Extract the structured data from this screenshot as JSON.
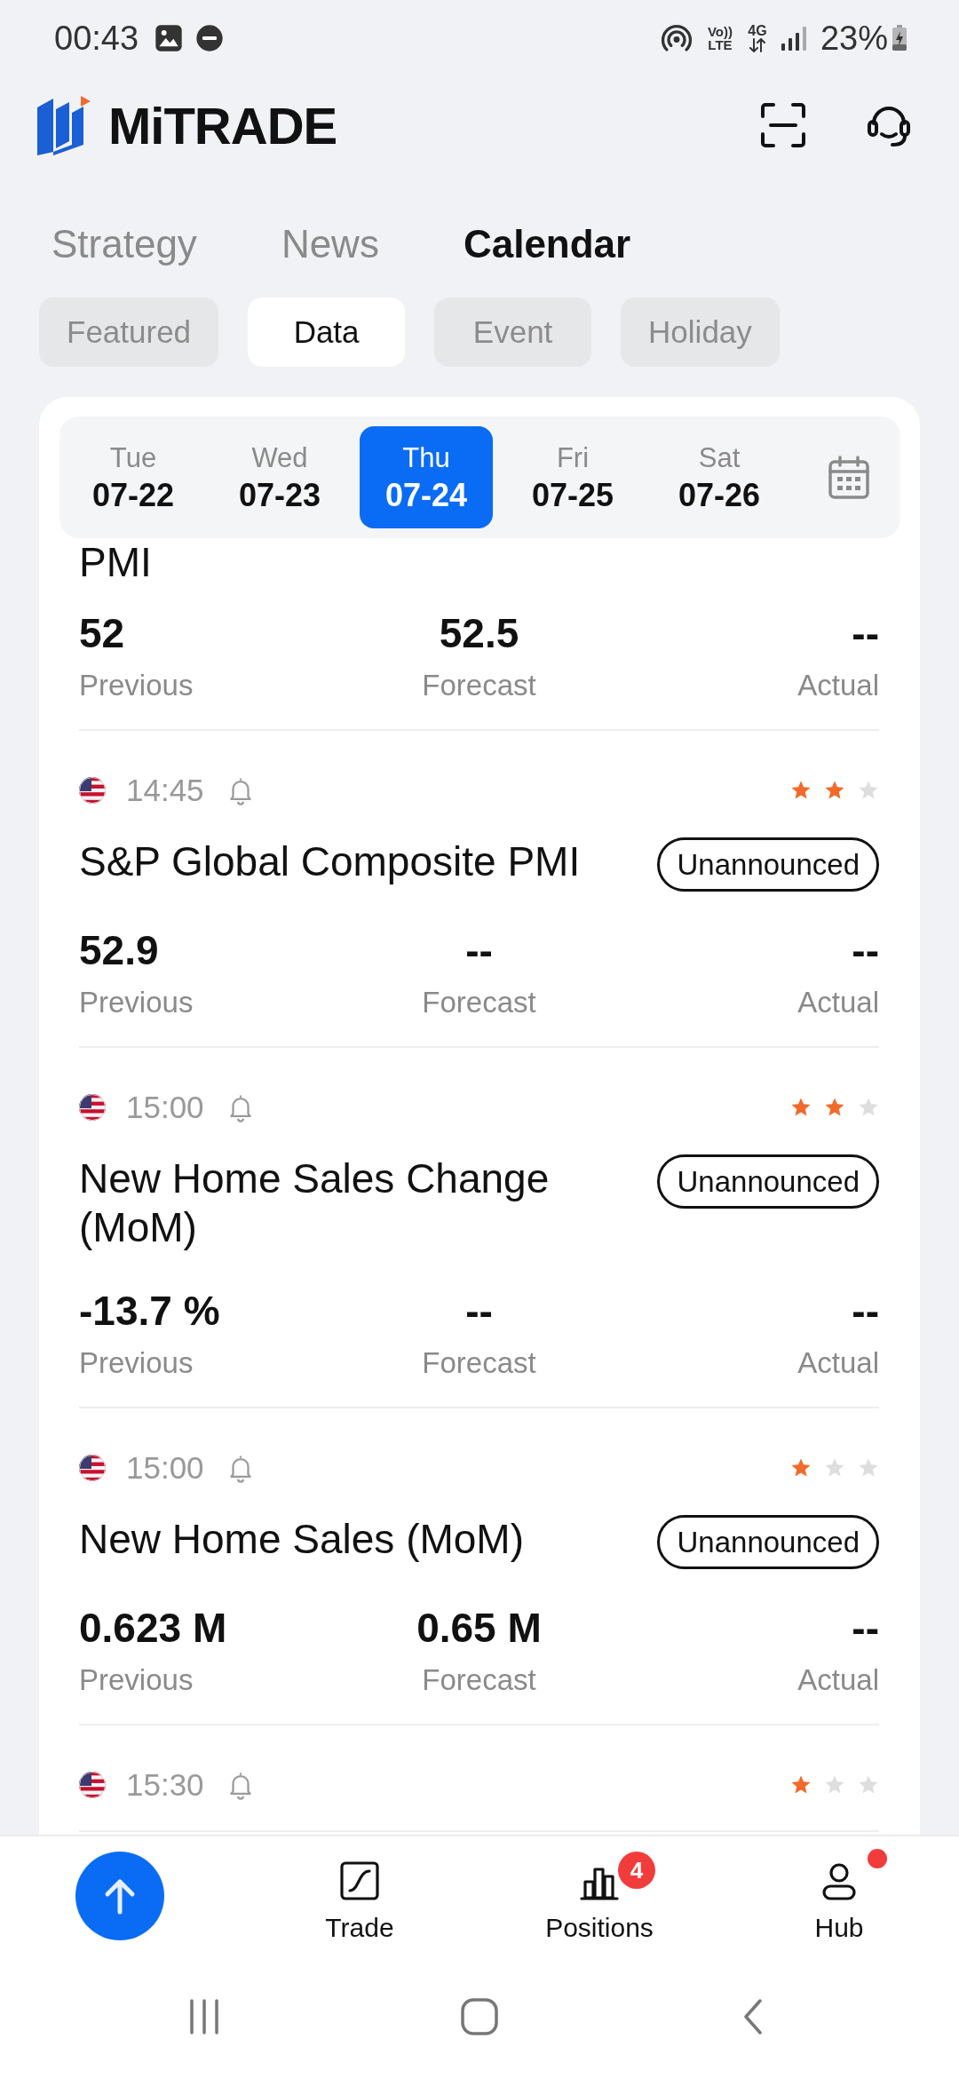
{
  "status_bar": {
    "time": "00:43",
    "volte": "Vo)) LTE",
    "network": "4G",
    "battery": "23%"
  },
  "header": {
    "logo": "MiTRADE"
  },
  "tabs": [
    {
      "label": "Strategy",
      "selected": false
    },
    {
      "label": "News",
      "selected": false
    },
    {
      "label": "Calendar",
      "selected": true
    }
  ],
  "filters": [
    {
      "label": "Featured",
      "selected": false
    },
    {
      "label": "Data",
      "selected": true
    },
    {
      "label": "Event",
      "selected": false
    },
    {
      "label": "Holiday",
      "selected": false
    }
  ],
  "dates": [
    {
      "day": "Tue",
      "date": "07-22",
      "selected": false
    },
    {
      "day": "Wed",
      "date": "07-23",
      "selected": false
    },
    {
      "day": "Thu",
      "date": "07-24",
      "selected": true
    },
    {
      "day": "Fri",
      "date": "07-25",
      "selected": false
    },
    {
      "day": "Sat",
      "date": "07-26",
      "selected": false
    }
  ],
  "events": [
    {
      "title": "PMI",
      "values": [
        {
          "value": "52",
          "label": "Previous"
        },
        {
          "value": "52.5",
          "label": "Forecast"
        },
        {
          "value": "--",
          "label": "Actual"
        }
      ]
    },
    {
      "time": "14:45",
      "stars": 2,
      "title": "S&P Global Composite PMI",
      "status": "Unannounced",
      "values": [
        {
          "value": "52.9",
          "label": "Previous"
        },
        {
          "value": "--",
          "label": "Forecast"
        },
        {
          "value": "--",
          "label": "Actual"
        }
      ]
    },
    {
      "time": "15:00",
      "stars": 2,
      "title": "New Home Sales Change (MoM)",
      "status": "Unannounced",
      "values": [
        {
          "value": "-13.7 %",
          "label": "Previous"
        },
        {
          "value": "--",
          "label": "Forecast"
        },
        {
          "value": "--",
          "label": "Actual"
        }
      ]
    },
    {
      "time": "15:00",
      "stars": 1,
      "title": "New Home Sales (MoM)",
      "status": "Unannounced",
      "values": [
        {
          "value": "0.623 M",
          "label": "Previous"
        },
        {
          "value": "0.65 M",
          "label": "Forecast"
        },
        {
          "value": "--",
          "label": "Actual"
        }
      ]
    },
    {
      "time": "15:30",
      "stars": 1
    }
  ],
  "bottom_nav": [
    {
      "kind": "up"
    },
    {
      "kind": "trade",
      "label": "Trade"
    },
    {
      "kind": "positions",
      "label": "Positions",
      "badge": "4"
    },
    {
      "kind": "hub",
      "label": "Hub",
      "dot": true
    }
  ]
}
